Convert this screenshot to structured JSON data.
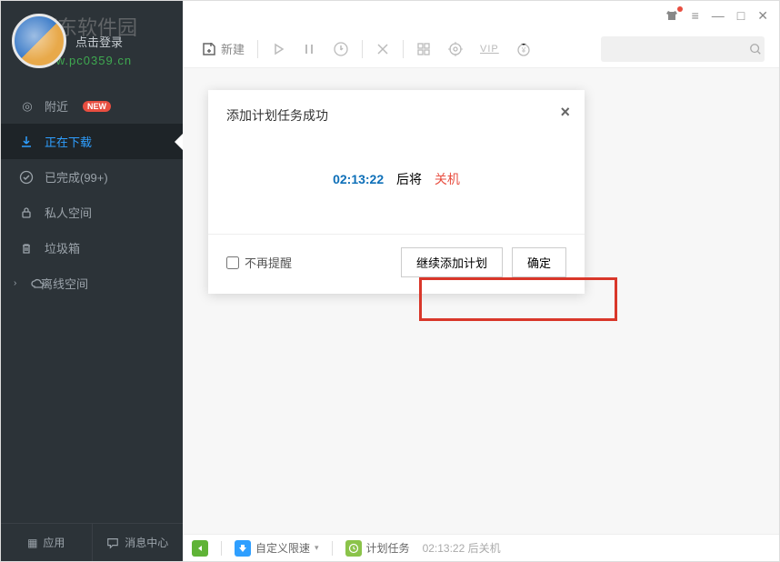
{
  "profile": {
    "login_text": "点击登录"
  },
  "watermark": {
    "line1": "河东软件园",
    "line2": "www.pc0359.cn"
  },
  "sidebar": {
    "items": [
      {
        "label": "附近",
        "badge": "NEW"
      },
      {
        "label": "正在下载"
      },
      {
        "label": "已完成(99+)"
      },
      {
        "label": "私人空间"
      },
      {
        "label": "垃圾箱"
      },
      {
        "label": "离线空间"
      }
    ],
    "bottom": {
      "apps": "应用",
      "msg": "消息中心"
    }
  },
  "toolbar": {
    "new_label": "新建"
  },
  "dialog": {
    "title": "添加计划任务成功",
    "time": "02:13:22",
    "mid": "后将",
    "action": "关机",
    "dont_remind": "不再提醒",
    "continue": "继续添加计划",
    "ok": "确定"
  },
  "status": {
    "speed": "自定义限速",
    "task": "计划任务",
    "info": "02:13:22 后关机"
  }
}
